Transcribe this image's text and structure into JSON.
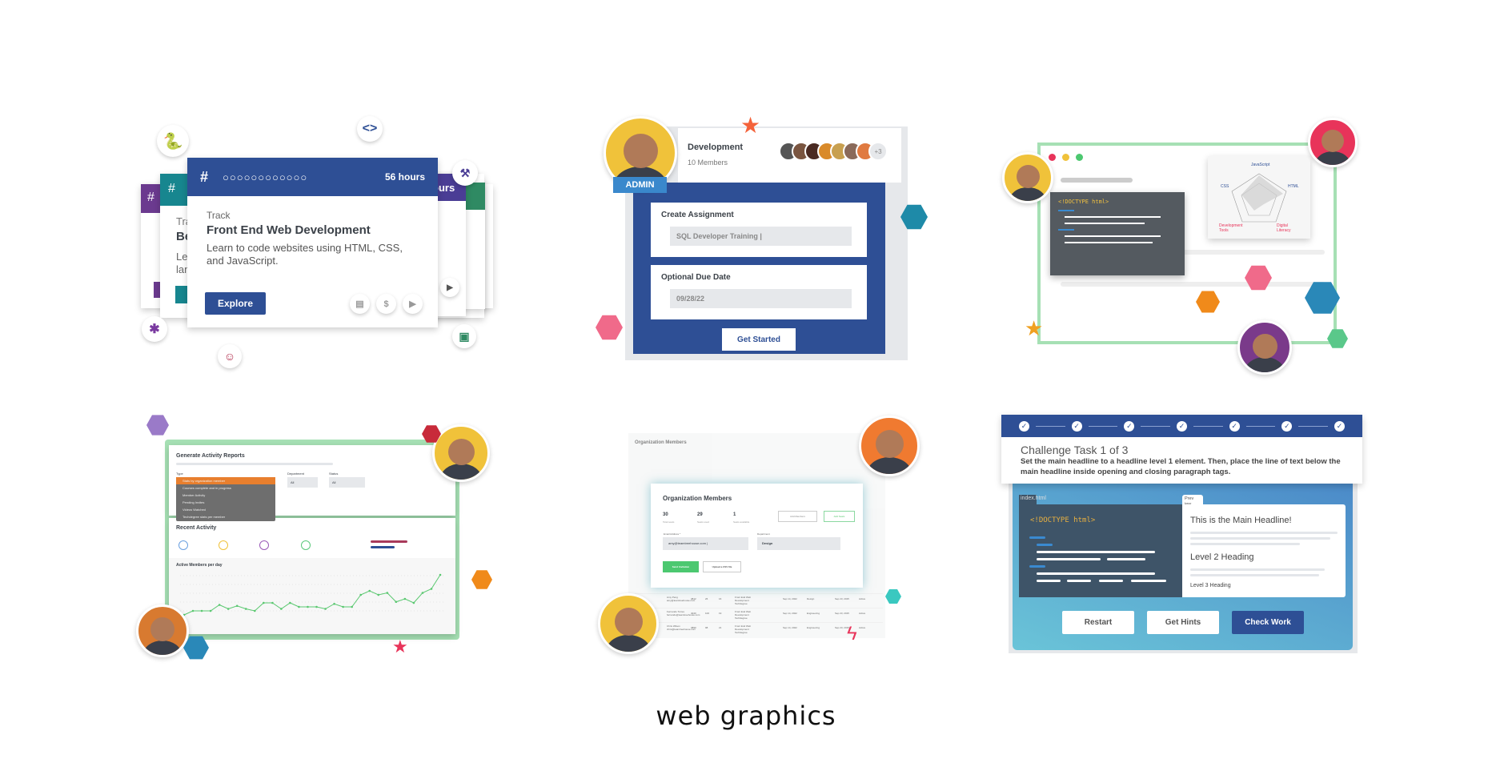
{
  "track_card": {
    "hours": "56 hours",
    "back_hours": "ours",
    "back_hours2": "urs",
    "eyebrow": "Track",
    "title": "Front End Web Development",
    "description": "Learn to code websites using HTML, CSS, and JavaScript.",
    "explore_label": "Explore",
    "back_eyebrow": "Tra",
    "back_title": "Be",
    "back_desc1": "Lea",
    "back_desc2": "lan",
    "colors": {
      "primary": "#2e4f95",
      "teal": "#17868f",
      "purple": "#6b3a8f",
      "green": "#2f8a63"
    }
  },
  "assignment": {
    "team_name": "Development",
    "member_count": "10 Members",
    "extra_members": "+3",
    "role_badge": "ADMIN",
    "create_label": "Create Assignment",
    "create_value": "SQL Developer Training |",
    "due_label": "Optional Due Date",
    "due_value": "09/28/22",
    "cta": "Get Started"
  },
  "skills": {
    "code": "<!DOCTYPE html>",
    "radar_axes": [
      "JavaScript",
      "HTML",
      "Digital Literacy",
      "Development Tools",
      "CSS"
    ]
  },
  "reports": {
    "title": "Generate Activity Reports",
    "type_label": "Type",
    "department_label": "Department",
    "department_value": "All",
    "status_label": "Status",
    "status_value": "All",
    "type_options": [
      "Stats by organization member",
      "Courses complete and in progress",
      "Member Activity",
      "Pending Invites",
      "Videos Watched",
      "Techdegree stats per member"
    ],
    "recent_activity": "Recent Activity",
    "chart_title": "Active Members per day",
    "series": [
      2,
      4,
      4,
      4,
      7,
      5,
      6.5,
      5,
      4,
      8,
      8,
      5,
      8,
      6,
      6,
      6,
      5,
      7.5,
      6,
      6,
      12,
      14,
      12,
      13,
      8.5,
      10,
      8,
      13,
      15,
      22
    ]
  },
  "members": {
    "bg_title": "Organization Members",
    "title": "Organization Members",
    "stats": [
      {
        "value": "30",
        "label": "Total seats"
      },
      {
        "value": "29",
        "label": "Seats used"
      },
      {
        "value": "1",
        "label": "Seats available"
      }
    ],
    "add_members": "Add Members",
    "add_seats": "Add Seats",
    "email_label": "Email Address *",
    "email_value": "amy@teamtreehouse.com |",
    "department_label": "Department",
    "department_value": "Design",
    "send_label": "Send Invitation",
    "upload_label": "Upload a CSV file",
    "rows": [
      {
        "name": "Amy Peng",
        "email": "amy@teamtreehouse.com",
        "n1": "3812",
        "n2": "26",
        "n3": "16",
        "track": "Front End Web Development Techdegree",
        "date": "Sep 14, 2022",
        "dept": "Design",
        "joined": "Sep 23, 2015",
        "status": "Active"
      },
      {
        "name": "Fernando Torres",
        "email": "fernando@teamtreehouse.com",
        "n1": "4040",
        "n2": "100",
        "n3": "19",
        "track": "Front End Web Development Techdegree",
        "date": "Sep 14, 2022",
        "dept": "Engineering",
        "joined": "Sep 23, 2015",
        "status": "Active"
      },
      {
        "name": "Chris Wilson",
        "email": "chris@teamtreehouse.com",
        "n1": "3890",
        "n2": "98",
        "n3": "21",
        "track": "Front End Web Development Techdegree",
        "date": "Sep 14, 2022",
        "dept": "Engineering",
        "joined": "Sep 23, 2015",
        "status": "Active"
      }
    ]
  },
  "challenge": {
    "title": "Challenge Task 1 of 3",
    "instructions": "Set the main headline to a headline level 1 element. Then, place the line of text below the main headline inside opening and closing paragraph tags.",
    "file_tab": "index.html",
    "preview_tab": "Prev iew",
    "code": "<!DOCTYPE html>",
    "preview_h1": "This is the Main Headline!",
    "preview_h2": "Level 2 Heading",
    "preview_h3": "Level 3 Heading",
    "restart": "Restart",
    "hints": "Get Hints",
    "check": "Check Work"
  },
  "caption": "web graphics"
}
